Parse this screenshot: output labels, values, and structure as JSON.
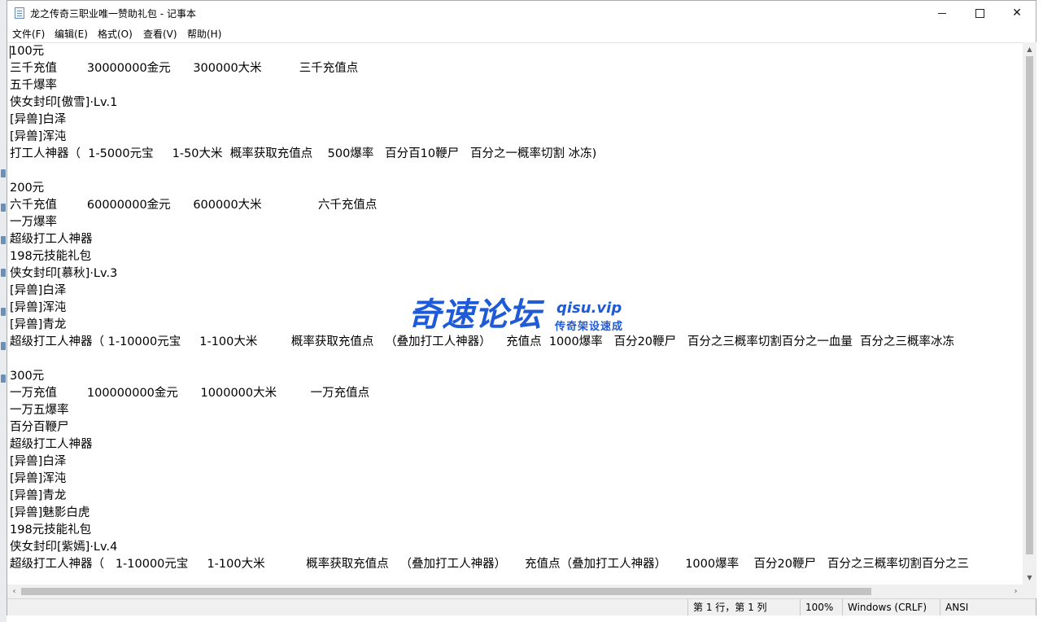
{
  "window": {
    "title": "龙之传奇三职业唯一赞助礼包 - 记事本"
  },
  "menu": [
    "文件(F)",
    "编辑(E)",
    "格式(O)",
    "查看(V)",
    "帮助(H)"
  ],
  "document": {
    "lines": [
      "100元",
      "三千充值        30000000金元      300000大米          三千充值点",
      "五千爆率",
      "侠女封印[傲雪]·Lv.1",
      "[异兽]白泽",
      "[异兽]浑沌",
      "打工人神器（  1-5000元宝     1-50大米  概率获取充值点    500爆率   百分百10鞭尸   百分之一概率切割 冰冻)",
      "",
      "200元",
      "六千充值        60000000金元      600000大米               六千充值点",
      "一万爆率",
      "超级打工人神器",
      "198元技能礼包",
      "侠女封印[慕秋]·Lv.3",
      "[异兽]白泽",
      "[异兽]浑沌",
      "[异兽]青龙",
      "超级打工人神器（ 1-10000元宝     1-100大米         概率获取充值点   （叠加打工人神器）    充值点  1000爆率   百分20鞭尸   百分之三概率切割百分之一血量  百分之三概率冰冻",
      "",
      "300元",
      "一万充值        100000000金元      1000000大米         一万充值点",
      "一万五爆率",
      "百分百鞭尸",
      "超级打工人神器",
      "[异兽]白泽",
      "[异兽]浑沌",
      "[异兽]青龙",
      "[异兽]魅影白虎",
      "198元技能礼包",
      "侠女封印[紫嫣]·Lv.4",
      "超级打工人神器（   1-10000元宝     1-100大米           概率获取充值点   （叠加打工人神器）     充值点（叠加打工人神器）     1000爆率    百分20鞭尸   百分之三概率切割百分之三"
    ]
  },
  "status": {
    "position": "第 1 行，第 1 列",
    "zoom": "100%",
    "line_ending": "Windows (CRLF)",
    "encoding": "ANSI"
  },
  "watermark": {
    "main": "奇速论坛",
    "url": "qisu.vip",
    "sub": "传奇架设速成"
  },
  "icons": {
    "app": "notepad-icon",
    "minimize": "minimize-icon",
    "maximize": "maximize-icon",
    "close": "close-icon"
  }
}
